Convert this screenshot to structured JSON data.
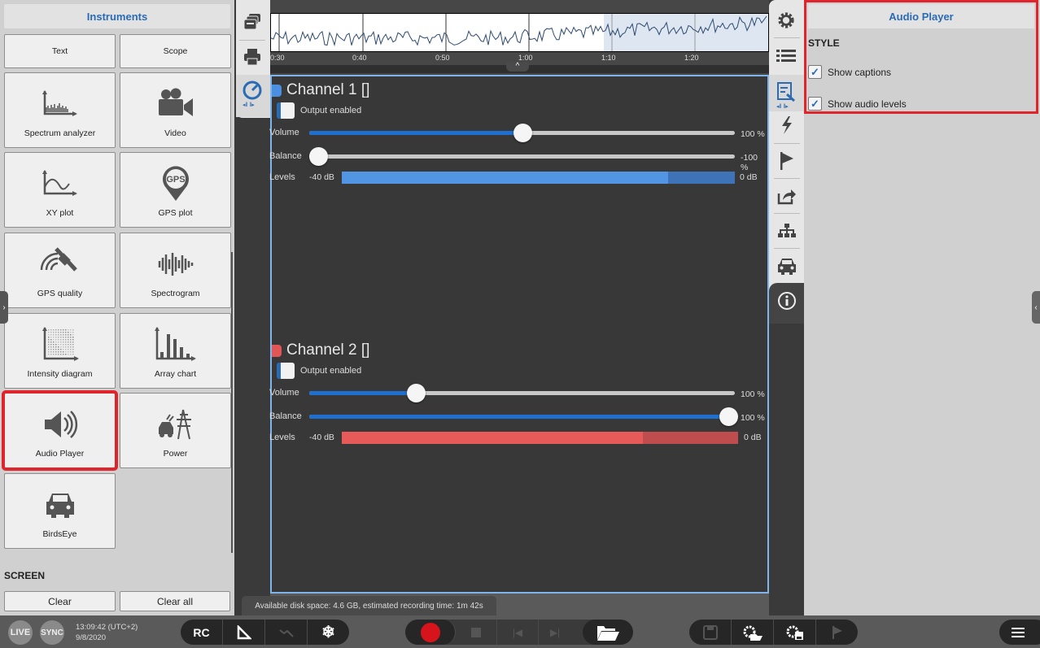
{
  "left_panel": {
    "title": "Instruments",
    "tiles": [
      {
        "label": "Text",
        "icon": "text-icon"
      },
      {
        "label": "Scope",
        "icon": "scope-icon"
      },
      {
        "label": "Spectrum analyzer",
        "icon": "spectrum-icon"
      },
      {
        "label": "Video",
        "icon": "video-camera-icon"
      },
      {
        "label": "XY plot",
        "icon": "xy-plot-icon"
      },
      {
        "label": "GPS plot",
        "icon": "gps-pin-icon"
      },
      {
        "label": "GPS quality",
        "icon": "satellite-icon"
      },
      {
        "label": "Spectrogram",
        "icon": "waveform-icon"
      },
      {
        "label": "Intensity diagram",
        "icon": "intensity-icon"
      },
      {
        "label": "Array chart",
        "icon": "bar-chart-icon"
      },
      {
        "label": "Audio Player",
        "icon": "speaker-icon",
        "selected": true
      },
      {
        "label": "Power",
        "icon": "power-icon"
      },
      {
        "label": "BirdsEye",
        "icon": "car-icon"
      }
    ],
    "screen_title": "SCREEN",
    "clear_label": "Clear",
    "clear_all_label": "Clear all"
  },
  "timeline": {
    "ticks": [
      "0:30",
      "0:40",
      "0:50",
      "1:00",
      "1:10",
      "1:20"
    ]
  },
  "channels": [
    {
      "title": "Channel 1 []",
      "color": "#4a8fe0",
      "output_label": "Output enabled",
      "output_enabled": false,
      "volume_label": "Volume",
      "volume_value": "100 %",
      "volume_fraction": 0.5,
      "balance_label": "Balance",
      "balance_value": "-100 %",
      "balance_fraction": 0.0,
      "levels_label": "Levels",
      "levels_min": "-40 dB",
      "levels_max": "0 dB",
      "level_fraction": 0.83,
      "level_color": "#5295e3",
      "level_bg": "#3f73b8"
    },
    {
      "title": "Channel 2 []",
      "color": "#e05555",
      "output_label": "Output enabled",
      "output_enabled": false,
      "volume_label": "Volume",
      "volume_value": "100 %",
      "volume_fraction": 0.25,
      "balance_label": "Balance",
      "balance_value": "100 %",
      "balance_fraction": 1.0,
      "levels_label": "Levels",
      "levels_min": "-40 dB",
      "levels_max": "0 dB",
      "level_fraction": 0.76,
      "level_color": "#e65a5a",
      "level_bg": "#c04d4d"
    }
  ],
  "right_panel": {
    "title": "Audio Player",
    "section": "STYLE",
    "options": [
      {
        "label": "Show captions",
        "checked": true
      },
      {
        "label": "Show audio levels",
        "checked": true
      }
    ]
  },
  "status": {
    "disk": "Available disk space: 4.6 GB, estimated recording time: 1m 42s",
    "time": "13:09:42 (UTC+2)",
    "date": "9/8/2020",
    "live": "LIVE",
    "sync": "SYNC",
    "rc": "RC"
  }
}
